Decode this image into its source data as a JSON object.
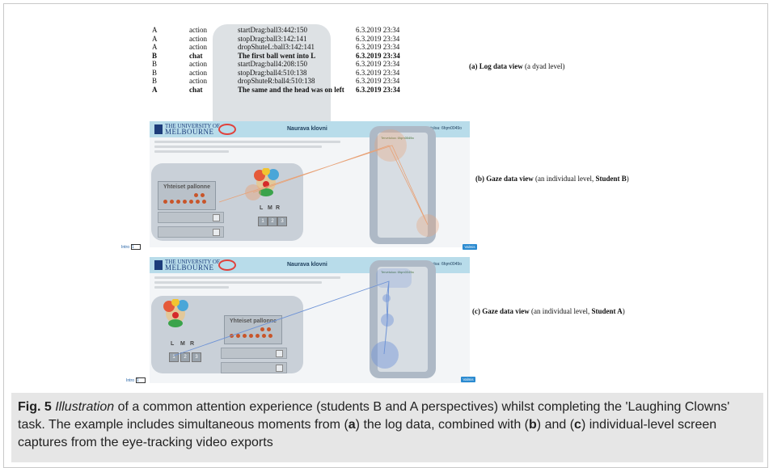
{
  "log": {
    "rows": [
      {
        "user": "A",
        "type": "action",
        "event": "startDrag:ball3:442:150",
        "time": "6.3.2019 23:34",
        "bold": false
      },
      {
        "user": "A",
        "type": "action",
        "event": "stopDrag:ball3:142:141",
        "time": "6.3.2019 23:34",
        "bold": false
      },
      {
        "user": "A",
        "type": "action",
        "event": "dropShuteL:ball3:142:141",
        "time": "6.3.2019 23:34",
        "bold": false
      },
      {
        "user": "B",
        "type": "chat",
        "event": "The first ball went into L",
        "time": "6.3.2019 23:34",
        "bold": true
      },
      {
        "user": "B",
        "type": "action",
        "event": "startDrag:ball4:208:150",
        "time": "6.3.2019 23:34",
        "bold": false
      },
      {
        "user": "B",
        "type": "action",
        "event": "stopDrag:ball4:510:138",
        "time": "6.3.2019 23:34",
        "bold": false
      },
      {
        "user": "B",
        "type": "action",
        "event": "dropShuteR:ball4:510:138",
        "time": "6.3.2019 23:34",
        "bold": false
      },
      {
        "user": "A",
        "type": "chat",
        "event": "The same and the head was on left",
        "time": "6.3.2019 23:34",
        "bold": true
      }
    ]
  },
  "labels": {
    "a": {
      "prefix": "(a) Log data view",
      "suffix": " (a dyad level)"
    },
    "b": {
      "prefix": "(b) Gaze data view",
      "middle": " (an individual level, ",
      "strong": "Student B",
      "suffix": ")"
    },
    "c": {
      "prefix": "(c) Gaze data view",
      "middle": " (an individual level, ",
      "strong": "Student A",
      "suffix": ")"
    }
  },
  "screens": {
    "university_line1": "THE UNIVERSITY OF",
    "university_line2": "MELBOURNE",
    "title": "Nauravа klovni",
    "right_header": "Tervetuloa: 6fqm0049o",
    "pool_label": "Yhteiset pallonne",
    "chute_labels": [
      "L",
      "M",
      "R"
    ],
    "bin_numbers": [
      "1",
      "2",
      "3"
    ],
    "intro_label": "Intro",
    "intro_value": "1",
    "valmis_label": "Valmis"
  },
  "caption": {
    "fig": "Fig. 5",
    "italic": "Illustration",
    "text1": " of a common attention experience (students B and A perspectives) whilst completing the 'Laughing Clowns' task. The example includes simultaneous moments from (",
    "a": "a",
    "text2": ") the log data, combined with (",
    "b": "b",
    "text3": ") and (",
    "c": "c",
    "text4": ") individual-level screen captures from the eye-tracking video exports"
  },
  "colors": {
    "header_blue": "#b8dcea",
    "gaze_orange": "#e8a277",
    "gaze_blue": "#6e93d6",
    "caption_bg": "#e6e6e6"
  }
}
